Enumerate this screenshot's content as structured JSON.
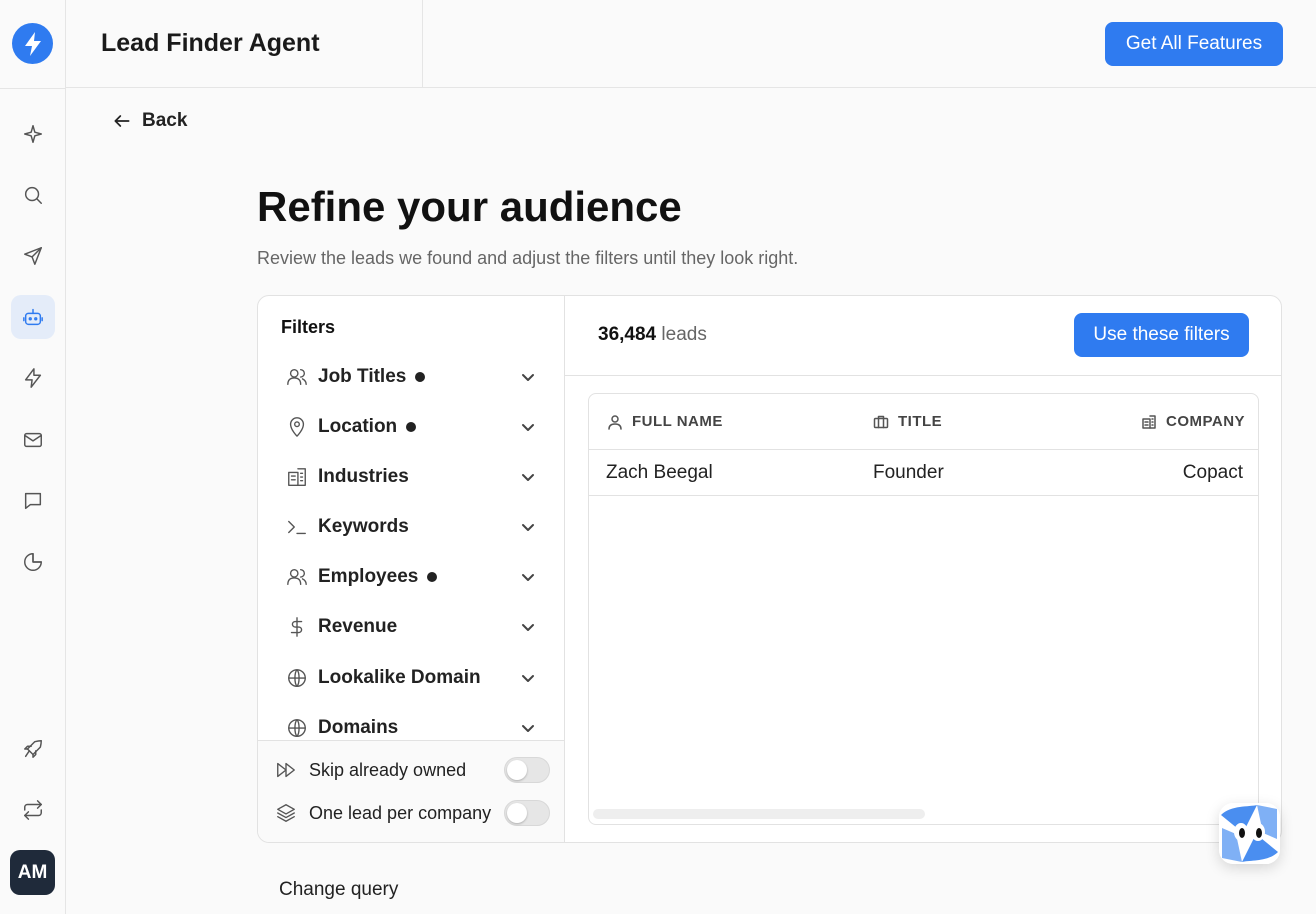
{
  "app": {
    "title": "Lead Finder Agent",
    "cta_label": "Get All Features",
    "brand_color": "#2f7bf0"
  },
  "sidebar": {
    "items": [
      {
        "icon": "sparkle-icon",
        "active": false
      },
      {
        "icon": "search-icon",
        "active": false
      },
      {
        "icon": "send-icon",
        "active": false
      },
      {
        "icon": "robot-icon",
        "active": true
      },
      {
        "icon": "lightning-icon",
        "active": false
      },
      {
        "icon": "mail-icon",
        "active": false
      },
      {
        "icon": "message-icon",
        "active": false
      },
      {
        "icon": "pie-chart-icon",
        "active": false
      }
    ],
    "bottom_items": [
      {
        "icon": "rocket-icon"
      },
      {
        "icon": "repeat-icon"
      }
    ],
    "avatar_initials": "AM"
  },
  "nav": {
    "back_label": "Back"
  },
  "page": {
    "title": "Refine your audience",
    "subtitle": "Review the leads we found and adjust the filters until they look right."
  },
  "filters": {
    "title": "Filters",
    "items": [
      {
        "label": "Job Titles",
        "icon": "users-icon",
        "active": true
      },
      {
        "label": "Location",
        "icon": "map-pin-icon",
        "active": true
      },
      {
        "label": "Industries",
        "icon": "building-icon",
        "active": false
      },
      {
        "label": "Keywords",
        "icon": "terminal-icon",
        "active": false
      },
      {
        "label": "Employees",
        "icon": "users-icon",
        "active": true
      },
      {
        "label": "Revenue",
        "icon": "dollar-icon",
        "active": false
      },
      {
        "label": "Lookalike Domain",
        "icon": "globe-icon",
        "active": false
      },
      {
        "label": "Domains",
        "icon": "globe-icon",
        "active": false
      }
    ],
    "toggles": [
      {
        "label": "Skip already owned",
        "icon": "fast-forward-icon",
        "on": false
      },
      {
        "label": "One lead per company",
        "icon": "layers-icon",
        "on": false
      }
    ]
  },
  "results": {
    "count": "36,484",
    "count_suffix": "leads",
    "apply_label": "Use these filters",
    "columns": [
      "FULL NAME",
      "TITLE",
      "COMPANY"
    ],
    "rows": [
      {
        "full_name": "Zach Beegal",
        "title": "Founder",
        "company": "Copact"
      }
    ]
  },
  "footer": {
    "change_query_label": "Change query"
  }
}
